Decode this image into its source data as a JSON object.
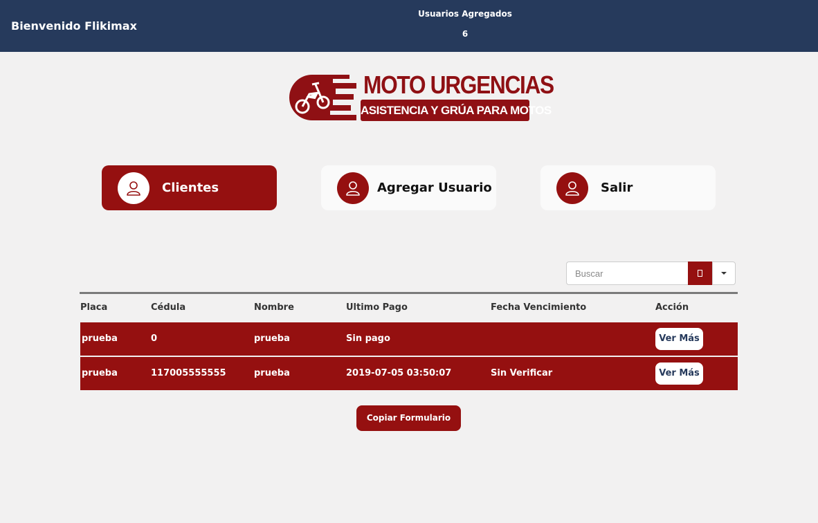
{
  "header": {
    "welcome": "Bienvenido Flikimax",
    "users_label": "Usuarios Agregados",
    "users_count": "6"
  },
  "logo": {
    "title": "MOTO URGENCIAS",
    "subtitle": "ASISTENCIA Y GRÚA PARA MOTOS",
    "brand_color": "#8f1014"
  },
  "nav": [
    {
      "label": "Clientes",
      "icon": "user-icon",
      "active": true
    },
    {
      "label": "Agregar Usuario",
      "icon": "user-icon",
      "active": false
    },
    {
      "label": "Salir",
      "icon": "user-icon",
      "active": false
    }
  ],
  "search": {
    "placeholder": "Buscar",
    "value": ""
  },
  "table": {
    "columns": [
      "Placa",
      "Cédula",
      "Nombre",
      "Ultimo Pago",
      "Fecha Vencimiento",
      "Acción"
    ],
    "rows": [
      {
        "placa": "prueba",
        "cedula": "0",
        "nombre": "prueba",
        "ultimo_pago": "Sin pago",
        "fecha_vencimiento": "",
        "accion": "Ver Más"
      },
      {
        "placa": "prueba",
        "cedula": "117005555555",
        "nombre": "prueba",
        "ultimo_pago": "2019-07-05 03:50:07",
        "fecha_vencimiento": "Sin Verificar",
        "accion": "Ver Más"
      }
    ]
  },
  "copy_button": "Copiar Formulario",
  "colors": {
    "header_bg": "#263a5c",
    "accent": "#951010",
    "page_bg": "#f2f1f1"
  }
}
